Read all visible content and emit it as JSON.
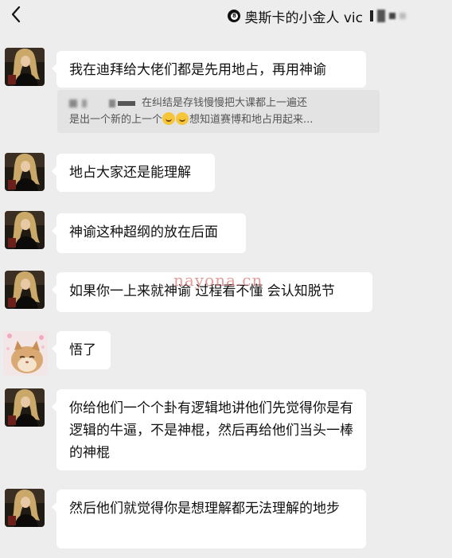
{
  "header": {
    "title": "奥斯卡的小金人 vic",
    "ball_number": "8"
  },
  "messages": [
    {
      "text": "我在迪拜给大佬们都是先用地占，再用神谕"
    },
    {
      "text": "地占大家还是能理解"
    },
    {
      "text": "神谕这种超纲的放在后面"
    },
    {
      "text": "如果你一上来就神谕 过程看不懂 会认知脱节"
    },
    {
      "text": "悟了"
    },
    {
      "text": "你给他们一个个卦有逻辑地讲他们先觉得你是有逻辑的牛逼，不是神棍，然后再给他们当头一棒的神棍"
    },
    {
      "text": "然后他们就觉得你是想理解都无法理解的地步"
    }
  ],
  "quote": {
    "line1": "在纠结是存钱慢慢把大课都上一遍还",
    "line2_a": "是出一个新的上一个",
    "line2_b": "想知道赛博和地占用起来..."
  },
  "watermark": "nayona.cn",
  "colors": {
    "background": "#ededed",
    "bubble": "#ffffff",
    "quote_bg": "#e3e3e3"
  },
  "icons": [
    "back-chevron-icon",
    "eight-ball-icon",
    "emoji-icon"
  ]
}
